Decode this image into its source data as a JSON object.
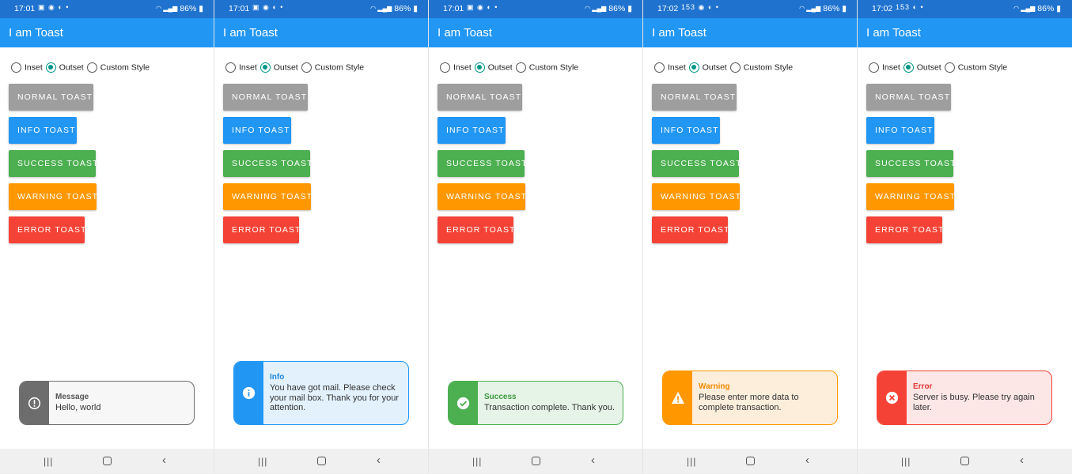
{
  "app_title": "I am Toast",
  "battery": "86%",
  "radio_options": [
    {
      "label": "Inset",
      "selected": false
    },
    {
      "label": "Outset",
      "selected": true
    },
    {
      "label": "Custom Style",
      "selected": false
    }
  ],
  "buttons": [
    {
      "label": "NORMAL TOAST",
      "color": "#9e9e9e"
    },
    {
      "label": "INFO TOAST",
      "color": "#2196f3"
    },
    {
      "label": "SUCCESS TOAST",
      "color": "#4caf50"
    },
    {
      "label": "WARNING TOAST",
      "color": "#ff9800"
    },
    {
      "label": "ERROR TOAST",
      "color": "#f44336"
    }
  ],
  "screens": [
    {
      "time": "17:01",
      "status_icons": "▣ ◉ ◐ •",
      "toast": {
        "type": "normal",
        "icon": "exclamation-circle-icon",
        "title": "Message",
        "message": "Hello, world",
        "accent": "#6d6d6d",
        "background": "#f7f7f7",
        "title_color": "#555555"
      }
    },
    {
      "time": "17:01",
      "status_icons": "▣ ◉ ◐ •",
      "toast": {
        "type": "info",
        "icon": "info-circle-icon",
        "title": "Info",
        "message": "You have got mail. Please check your mail box. Thank you for your attention.",
        "accent": "#2196f3",
        "background": "#e3f1fc",
        "title_color": "#1f86dd"
      }
    },
    {
      "time": "17:01",
      "status_icons": "▣ ◉ ◐ •",
      "toast": {
        "type": "success",
        "icon": "check-circle-icon",
        "title": "Success",
        "message": "Transaction complete. Thank you.",
        "accent": "#4caf50",
        "background": "#e6f3e7",
        "title_color": "#3d9a40"
      }
    },
    {
      "time": "17:02",
      "status_icons": "153 ◉ ◐ •",
      "toast": {
        "type": "warning",
        "icon": "warning-triangle-icon",
        "title": "Warning",
        "message": "Please enter more data to complete transaction.",
        "accent": "#ff9800",
        "background": "#fdeedc",
        "title_color": "#f08a00"
      }
    },
    {
      "time": "17:02",
      "status_icons": "153 ◐ •",
      "toast": {
        "type": "error",
        "icon": "error-circle-icon",
        "title": "Error",
        "message": "Server is busy. Please try again later.",
        "accent": "#f44336",
        "background": "#fde6e6",
        "title_color": "#e53935"
      }
    }
  ]
}
